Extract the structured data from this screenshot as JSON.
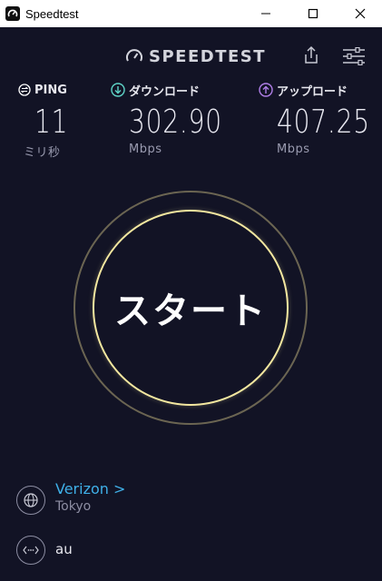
{
  "window": {
    "title": "Speedtest",
    "controls": {
      "minimize": "minimize-icon",
      "maximize": "maximize-icon",
      "close": "close-icon"
    }
  },
  "header": {
    "logo_text": "SPEEDTEST",
    "share_icon": "share-icon",
    "settings_icon": "sliders-icon"
  },
  "metrics": {
    "ping": {
      "label": "PING",
      "value": "11",
      "unit": "ミリ秒",
      "icon": "ping-icon",
      "color": "#ffffff"
    },
    "download": {
      "label": "ダウンロード",
      "value": "302.90",
      "unit": "Mbps",
      "icon": "download-arrow-icon",
      "color": "#5fd4c8"
    },
    "upload": {
      "label": "アップロード",
      "value": "407.25",
      "unit": "Mbps",
      "icon": "upload-arrow-icon",
      "color": "#b07fe8"
    }
  },
  "start_button": {
    "label": "スタート",
    "ring_color": "#f4e8a0"
  },
  "server": {
    "name": "Verizon >",
    "location": "Tokyo",
    "icon": "globe-icon",
    "name_color": "#3fb0e8"
  },
  "isp": {
    "name": "au",
    "icon": "connection-icon"
  },
  "colors": {
    "background": "#121325",
    "accent": "#3fb0e8"
  }
}
